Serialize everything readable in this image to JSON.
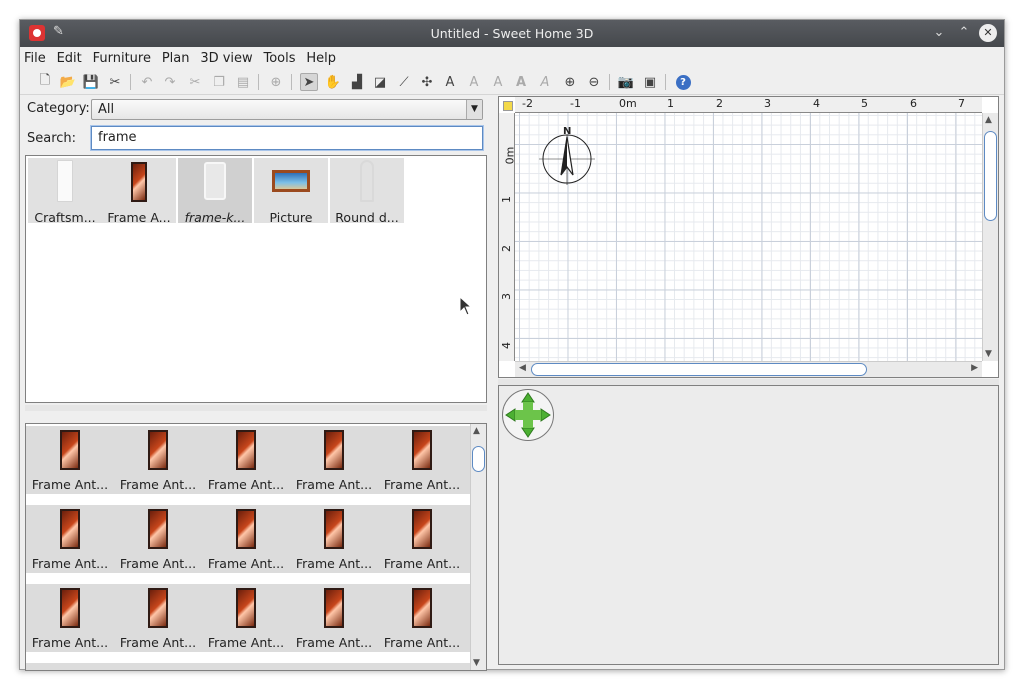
{
  "window": {
    "title": "Untitled - Sweet Home 3D"
  },
  "menu": [
    "File",
    "Edit",
    "Furniture",
    "Plan",
    "3D view",
    "Tools",
    "Help"
  ],
  "catalog": {
    "category_label": "Category:",
    "category_value": "All",
    "search_label": "Search:",
    "search_value": "frame",
    "items": [
      {
        "label": "Craftsm...",
        "icon": "door-icon"
      },
      {
        "label": "Frame A...",
        "icon": "frame-door-icon"
      },
      {
        "label": "frame-k...",
        "icon": "glass-frame-icon"
      },
      {
        "label": "Picture",
        "icon": "picture-icon"
      },
      {
        "label": "Round d...",
        "icon": "round-door-icon"
      }
    ]
  },
  "furniture": {
    "rows": [
      [
        "Frame Ant...",
        "Frame Ant...",
        "Frame Ant...",
        "Frame Ant...",
        "Frame Ant..."
      ],
      [
        "Frame Ant...",
        "Frame Ant...",
        "Frame Ant...",
        "Frame Ant...",
        "Frame Ant..."
      ],
      [
        "Frame Ant...",
        "Frame Ant...",
        "Frame Ant...",
        "Frame Ant...",
        "Frame Ant..."
      ]
    ]
  },
  "plan": {
    "h_ruler": [
      "-2",
      "-1",
      "0m",
      "1",
      "2",
      "3",
      "4",
      "5",
      "6",
      "7"
    ],
    "v_ruler": [
      "0m",
      "1",
      "2",
      "3",
      "4"
    ],
    "compass_label": "N"
  }
}
